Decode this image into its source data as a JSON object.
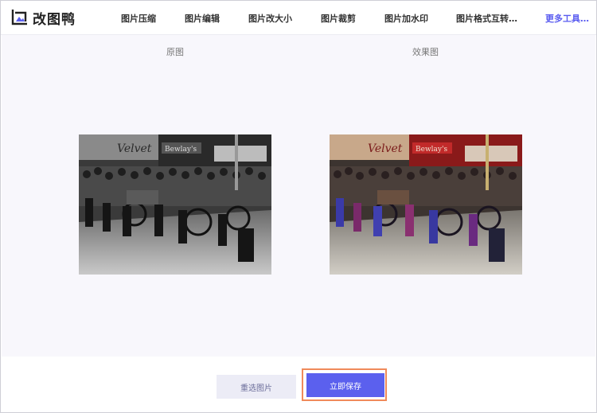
{
  "app": {
    "name": "改图鸭",
    "brand_color": "#5b60ee",
    "logo_icon": "image-frame-icon"
  },
  "nav": {
    "items": [
      {
        "label": "图片压缩"
      },
      {
        "label": "图片编辑"
      },
      {
        "label": "图片改大小"
      },
      {
        "label": "图片裁剪"
      },
      {
        "label": "图片加水印"
      },
      {
        "label": "图片格式互转…"
      }
    ],
    "more_label": "更多工具…"
  },
  "compare": {
    "original_label": "原图",
    "result_label": "效果图",
    "original_image": "black-and-white-street-parade-photo",
    "result_image": "colorized-street-parade-photo",
    "sign_left": "Velvet",
    "sign_right": "Bewlay's"
  },
  "actions": {
    "reselect_label": "重选图片",
    "save_label": "立即保存",
    "save_highlight_color": "#f08a5a"
  }
}
